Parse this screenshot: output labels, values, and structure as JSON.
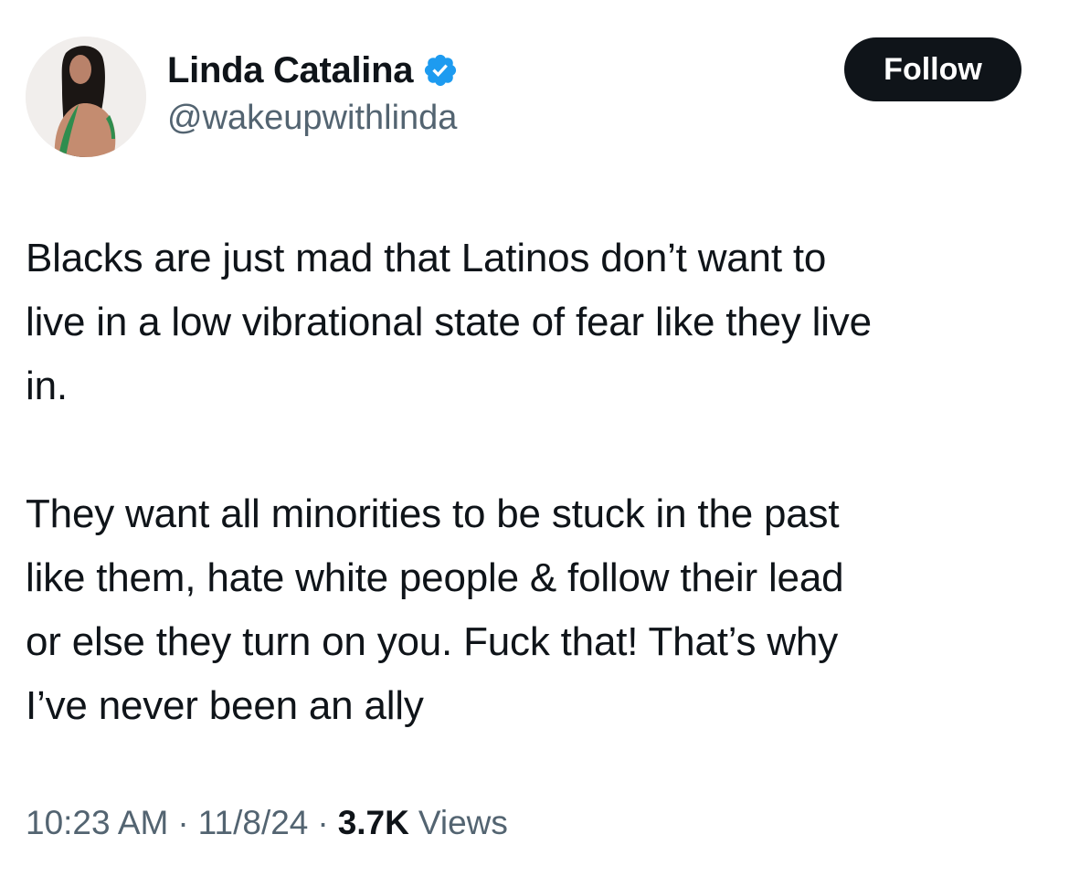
{
  "author": {
    "display_name": "Linda Catalina",
    "handle": "@wakeupwithlinda",
    "verified_badge_color": "#1d9bf0",
    "avatar_icon": "profile-photo"
  },
  "actions": {
    "follow_label": "Follow"
  },
  "tweet": {
    "paragraphs": [
      {
        "lines": [
          "Blacks are just mad that Latinos don’t want to",
          "live in a low vibrational state of fear like they live",
          "in."
        ]
      },
      {
        "lines": [
          "They want all minorities to be stuck in the past",
          "like them, hate white people & follow their lead",
          "or else they turn on you. Fuck that! That’s why",
          "I’ve never been an ally"
        ]
      }
    ]
  },
  "meta": {
    "time": "10:23 AM",
    "separator": "·",
    "date": "11/8/24",
    "views_count": "3.7K",
    "views_label": "Views"
  },
  "colors": {
    "text_primary": "#0f1419",
    "text_secondary": "#536471",
    "button_bg": "#0f1419",
    "button_text": "#ffffff",
    "background": "#ffffff"
  }
}
